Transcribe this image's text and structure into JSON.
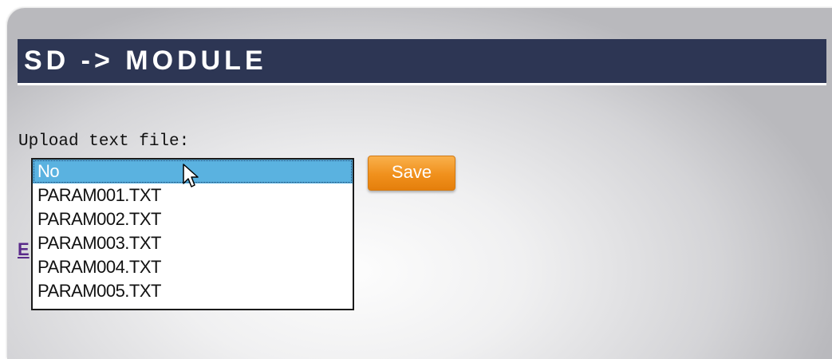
{
  "header": {
    "title": "SD -> MODULE"
  },
  "upload": {
    "label": "Upload text file:",
    "options": [
      "No",
      "PARAM001.TXT",
      "PARAM002.TXT",
      "PARAM003.TXT",
      "PARAM004.TXT",
      "PARAM005.TXT"
    ],
    "selected": "No"
  },
  "actions": {
    "save_label": "Save"
  },
  "partial_link": {
    "visible_text": "E"
  },
  "colors": {
    "title_bar": "#2d3654",
    "selected_option": "#5ab2e0",
    "save_button": "#f0901c",
    "link": "#5a2a8a"
  },
  "icons": {
    "cursor": "mouse-pointer-icon"
  }
}
